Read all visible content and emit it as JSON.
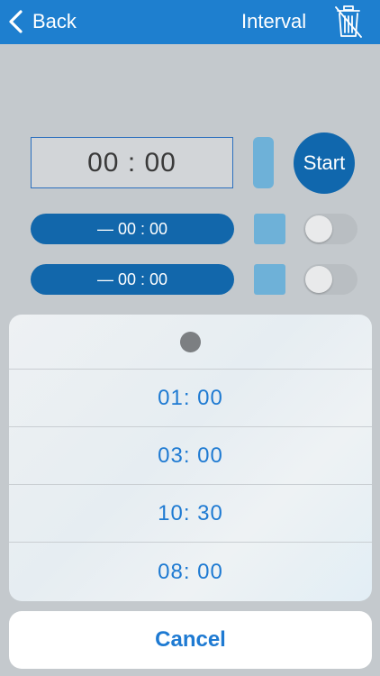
{
  "navbar": {
    "back_label": "Back",
    "title": "Interval",
    "back_icon": "chevron-left-icon",
    "trash_icon": "trash-icon",
    "color": "#1e7fcf"
  },
  "timer": {
    "value": "00 : 00",
    "start_label": "Start"
  },
  "intervals": [
    {
      "value": "— 00 : 00",
      "enabled": false
    },
    {
      "value": "— 00 : 00",
      "enabled": false
    }
  ],
  "sheet": {
    "options": [
      "01:  00",
      "03:  00",
      "10:  30",
      "08:  00"
    ],
    "cancel_label": "Cancel",
    "accent": "#1e7ad2"
  }
}
